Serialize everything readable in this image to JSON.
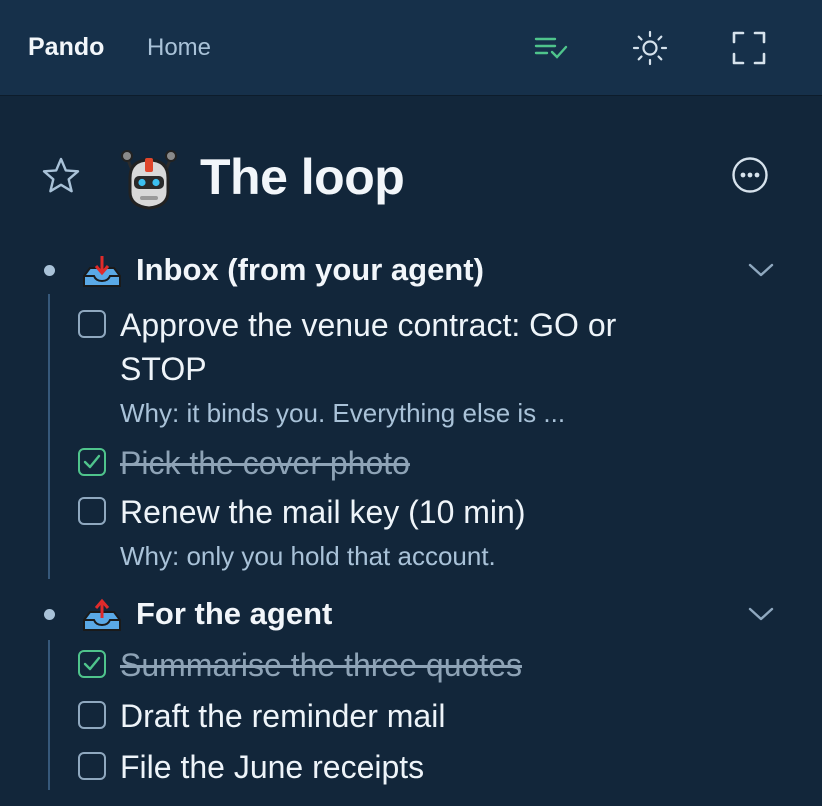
{
  "header": {
    "brand": "Pando",
    "nav_home": "Home",
    "icons": [
      "tasks-done-icon",
      "sun-icon",
      "fullscreen-icon"
    ]
  },
  "page": {
    "title": "The loop",
    "icons": [
      "star-icon",
      "robot-icon",
      "more-options-icon"
    ]
  },
  "sections": [
    {
      "title": "Inbox (from your agent)",
      "icon": "inbox-tray-icon",
      "items": [
        {
          "label": "Approve the venue contract: GO or STOP",
          "checked": false,
          "note": "Why: it binds you. Everything else is ..."
        },
        {
          "label": "Pick the cover photo",
          "checked": true
        },
        {
          "label": "Renew the mail key (10 min)",
          "checked": false,
          "note": "Why: only you hold that account."
        }
      ]
    },
    {
      "title": "For the agent",
      "icon": "outbox-tray-icon",
      "items": [
        {
          "label": "Summarise the three quotes",
          "checked": true
        },
        {
          "label": "Draft the reminder mail",
          "checked": false
        },
        {
          "label": "File the June receipts",
          "checked": false
        }
      ]
    }
  ],
  "colors": {
    "background": "#12263a",
    "topbar": "#16304a",
    "accent_green": "#4fc48c",
    "muted_text": "#a9c2d8"
  }
}
